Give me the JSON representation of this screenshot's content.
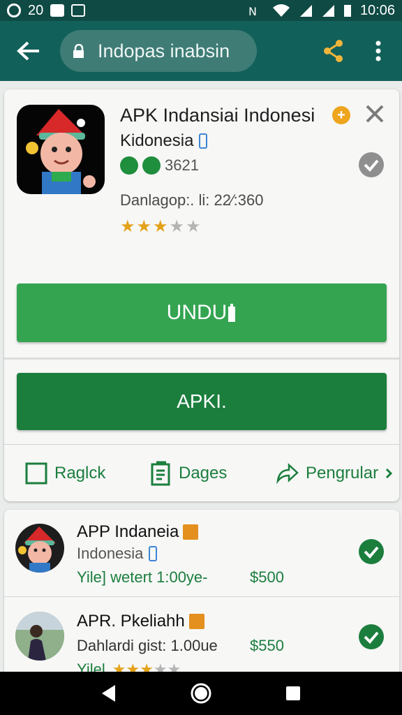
{
  "status_bar": {
    "left_number": "20",
    "time": "10:06"
  },
  "app_bar": {
    "url_text": "Indopas inabsin"
  },
  "app": {
    "title": "APK Indansiai Indonesi",
    "publisher": "Kidonesia",
    "count": "3621",
    "downloads": "Danlagop:. li: 22⁄:360",
    "rating_stars": 3,
    "rating_max": 5
  },
  "buttons": {
    "unduh": "UNDU",
    "apk": "APKI."
  },
  "actions": [
    {
      "label": "Raglck",
      "icon": "checkbox-icon"
    },
    {
      "label": "Dages",
      "icon": "document-icon"
    },
    {
      "label": "Pengrular",
      "icon": "share-arrow-icon"
    }
  ],
  "list": [
    {
      "title": "APP Indaneia",
      "subtitle": "Indonesia",
      "meta": "Yile]  wetert 1:00ye-",
      "price": "$500"
    },
    {
      "title": "APR. Pkeliahh",
      "meta": "Dahlardi gist: 1.00ue",
      "price": "$550",
      "extra": "Yilel"
    }
  ],
  "colors": {
    "status_bar": "#0f4a44",
    "app_bar": "#12605a",
    "primary_green": "#34a451",
    "dark_green": "#1b7e3d",
    "star": "#e3a21a",
    "badge_orange": "#eea51d"
  }
}
